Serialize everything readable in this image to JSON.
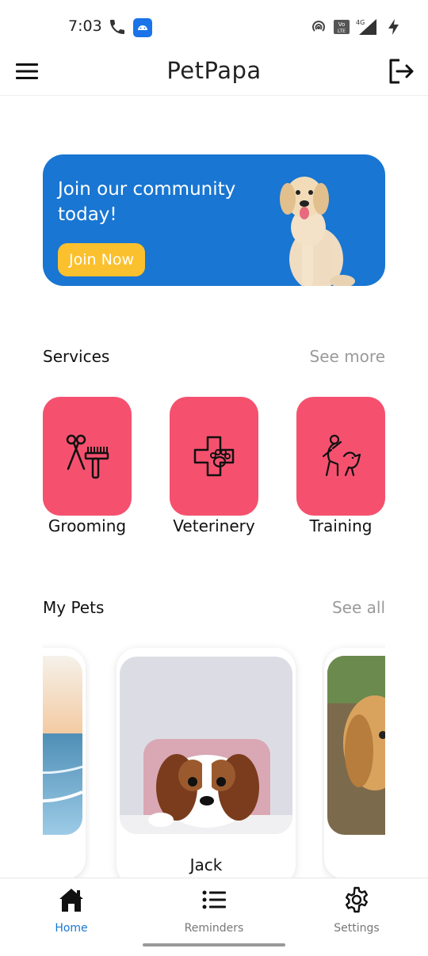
{
  "status_bar": {
    "time": "7:03",
    "icons": [
      "phone-icon",
      "app-notification-icon",
      "hotspot-icon",
      "volte-icon",
      "signal-4g-icon",
      "charging-icon"
    ]
  },
  "app_bar": {
    "title": "PetPapa",
    "menu_icon": "hamburger-menu-icon",
    "logout_icon": "logout-icon"
  },
  "banner": {
    "text": "Join our community today!",
    "button_label": "Join Now",
    "background_color": "#1976d2",
    "button_color": "#fbc02d"
  },
  "services": {
    "title": "Services",
    "see_more": "See more",
    "accent_color": "#f5516f",
    "items": [
      {
        "label": "Grooming",
        "icon": "grooming-icon"
      },
      {
        "label": "Veterinery",
        "icon": "veterinary-icon"
      },
      {
        "label": "Training",
        "icon": "training-icon"
      }
    ]
  },
  "pets": {
    "title": "My Pets",
    "see_all": "See all",
    "items": [
      {
        "name": ""
      },
      {
        "name": "Jack"
      },
      {
        "name": ""
      }
    ]
  },
  "bottom_nav": {
    "active_color": "#1976d2",
    "items": [
      {
        "label": "Home",
        "icon": "home-icon",
        "active": true
      },
      {
        "label": "Reminders",
        "icon": "list-icon",
        "active": false
      },
      {
        "label": "Settings",
        "icon": "gear-icon",
        "active": false
      }
    ]
  }
}
